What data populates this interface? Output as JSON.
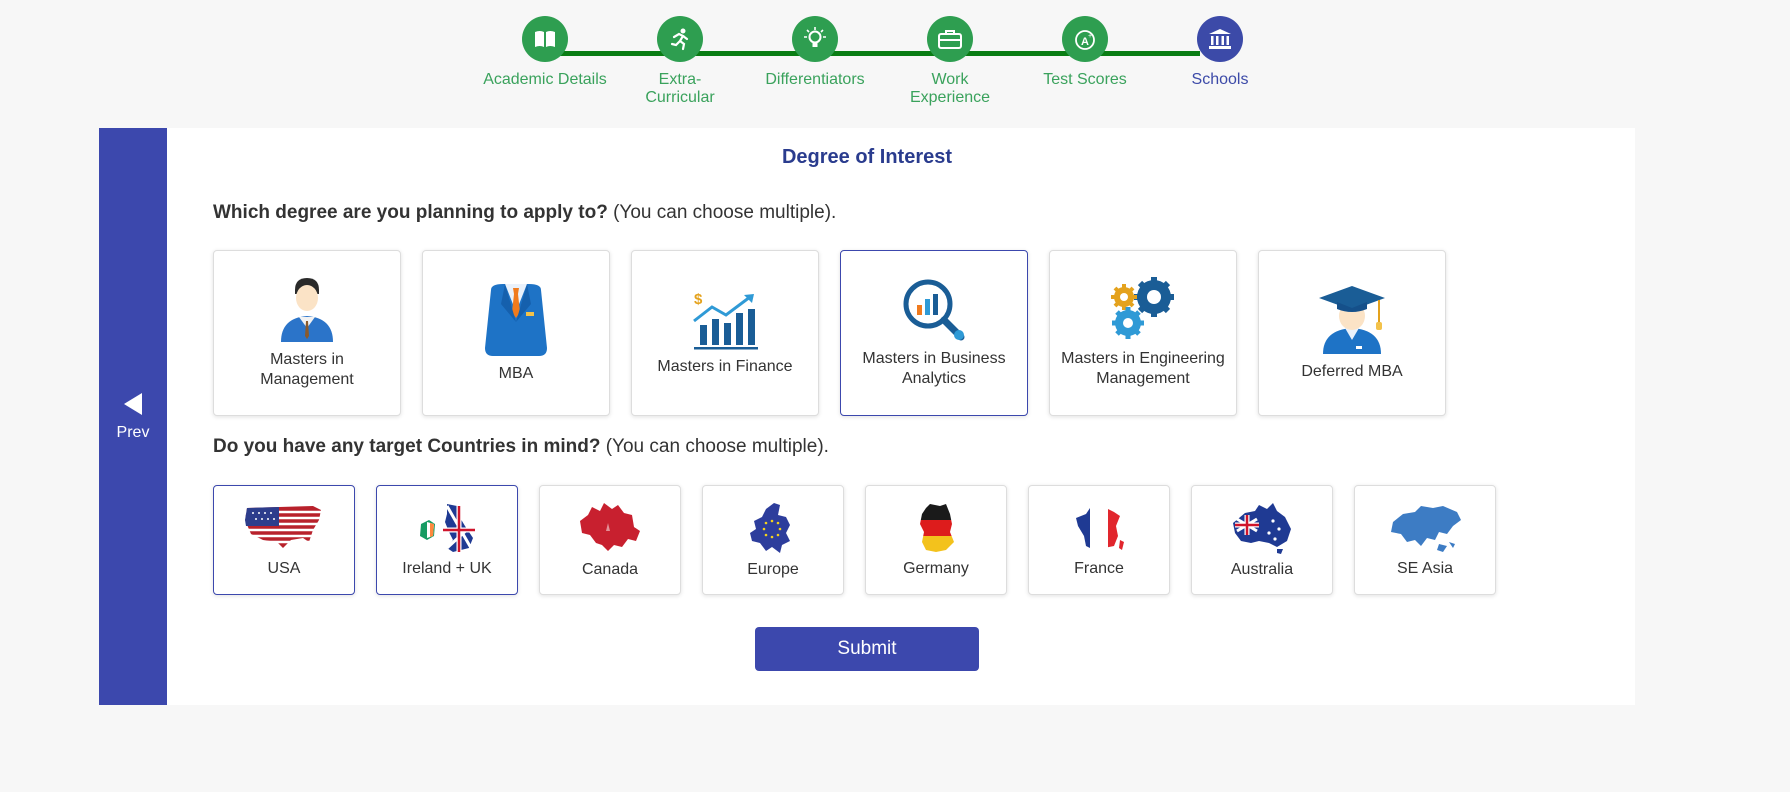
{
  "stepper": {
    "steps": [
      {
        "label": "Academic Details",
        "icon": "book-icon"
      },
      {
        "label": "Extra-Curricular",
        "icon": "running-icon"
      },
      {
        "label": "Differentiators",
        "icon": "lightbulb-icon"
      },
      {
        "label": "Work Experience",
        "icon": "briefcase-icon"
      },
      {
        "label": "Test Scores",
        "icon": "grade-icon"
      },
      {
        "label": "Schools",
        "icon": "institution-icon"
      }
    ],
    "active_color": "#3c4aa8",
    "done_color": "#2e9e50"
  },
  "nav": {
    "prev_label": "Prev"
  },
  "form": {
    "title": "Degree of Interest",
    "degree_question_bold": "Which degree are you planning to apply to?",
    "degree_question_rest": " (You can choose multiple).",
    "country_question_bold": "Do you have any target Countries in mind?",
    "country_question_rest": " (You can choose multiple).",
    "degrees": [
      {
        "label": "Masters in Management",
        "icon": "manager-icon",
        "selected": false
      },
      {
        "label": "MBA",
        "icon": "suit-icon",
        "selected": false
      },
      {
        "label": "Masters in Finance",
        "icon": "finance-chart-icon",
        "selected": false
      },
      {
        "label": "Masters in Business Analytics",
        "icon": "analytics-magnifier-icon",
        "selected": true
      },
      {
        "label": "Masters in Engineering Management",
        "icon": "gears-icon",
        "selected": false
      },
      {
        "label": "Deferred MBA",
        "icon": "graduate-icon",
        "selected": false
      }
    ],
    "countries": [
      {
        "label": "USA",
        "icon": "usa-map-icon",
        "selected": true
      },
      {
        "label": "Ireland + UK",
        "icon": "uk-ireland-map-icon",
        "selected": true
      },
      {
        "label": "Canada",
        "icon": "canada-map-icon",
        "selected": false
      },
      {
        "label": "Europe",
        "icon": "europe-map-icon",
        "selected": false
      },
      {
        "label": "Germany",
        "icon": "germany-map-icon",
        "selected": false
      },
      {
        "label": "France",
        "icon": "france-map-icon",
        "selected": false
      },
      {
        "label": "Australia",
        "icon": "australia-map-icon",
        "selected": false
      },
      {
        "label": "SE Asia",
        "icon": "asia-map-icon",
        "selected": false
      }
    ],
    "submit_label": "Submit",
    "accent": "#3c48ad"
  }
}
